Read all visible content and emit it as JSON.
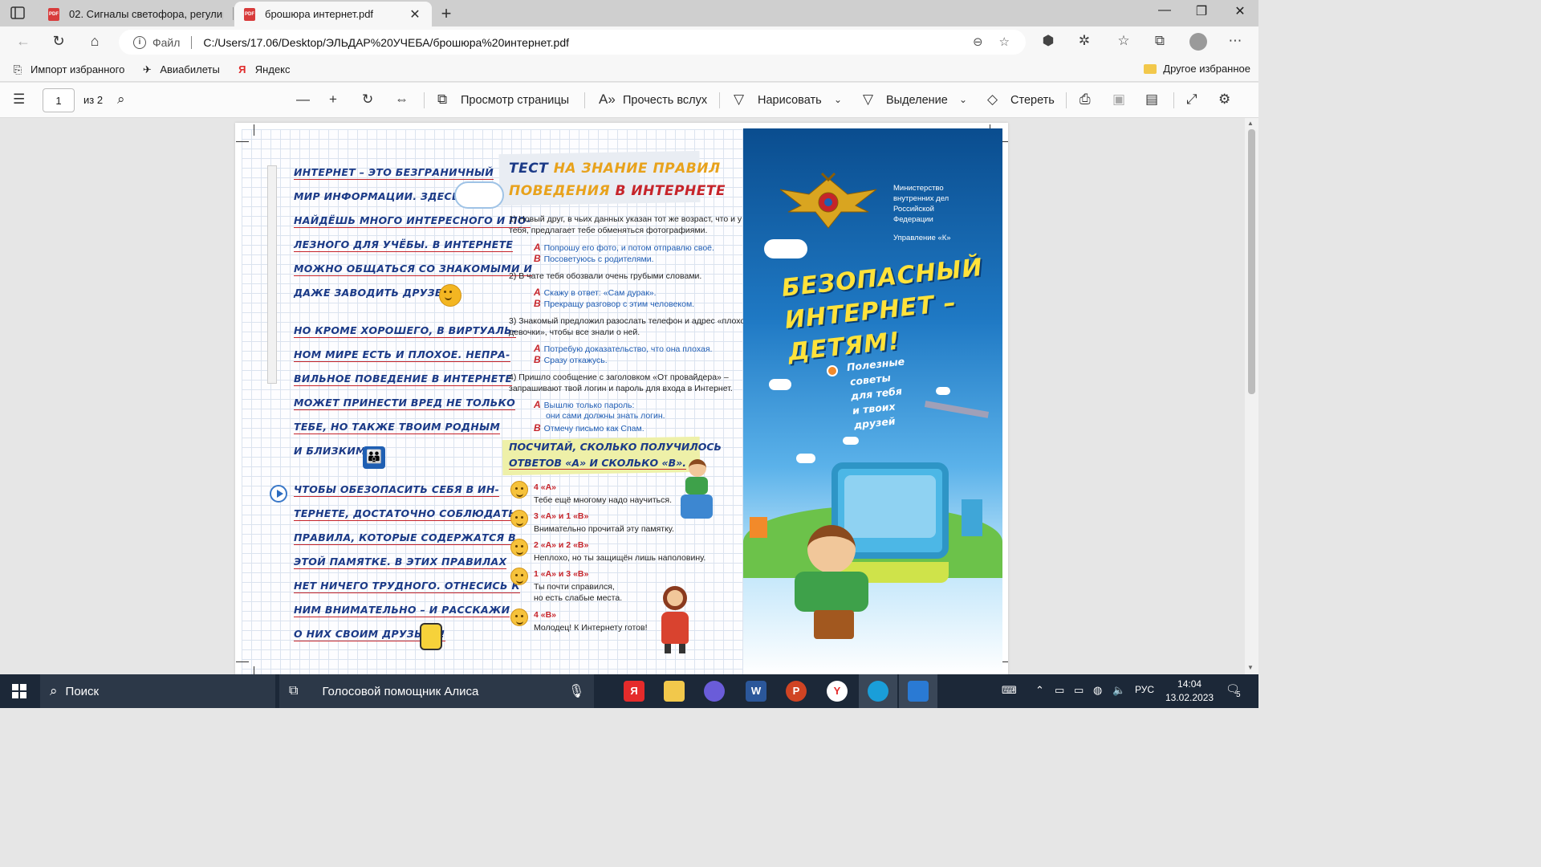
{
  "browser": {
    "tabs": [
      {
        "title": "02. Сигналы светофора, регулир",
        "active": false,
        "icon": "pdf-icon"
      },
      {
        "title": "брошюра интернет.pdf",
        "active": true,
        "icon": "pdf-icon"
      }
    ],
    "address": {
      "scheme_label": "Файл",
      "path": "C:/Users/17.06/Desktop/ЭЛЬДАР%20УЧЕБА/брошюра%20интернет.pdf"
    },
    "favorites": [
      {
        "label": "Импорт избранного",
        "icon": "import-icon"
      },
      {
        "label": "Авиабилеты",
        "icon": "plane-icon"
      },
      {
        "label": "Яндекс",
        "icon": "yandex-icon"
      }
    ],
    "other_favorites": "Другое избранное"
  },
  "pdf_toolbar": {
    "page_number": "1",
    "page_total": "из 2",
    "view_label": "Просмотр страницы",
    "read_aloud_label": "Прочесть вслух",
    "draw_label": "Нарисовать",
    "highlight_label": "Выделение",
    "erase_label": "Стереть"
  },
  "brochure": {
    "left_lines": [
      "интернет – это безграничный",
      "мир информации. Здесь ты",
      "найдёшь много интересного и по-",
      "лезного для учёбы. В Интернете",
      "можно общаться со знакомыми и",
      "даже заводить друзей.",
      "Но кроме хорошего, в виртуаль-",
      "ном мире есть и плохое. Непра-",
      "вильное поведение в Интернете",
      "может принести вред не только",
      "тебе, но также твоим родным",
      "и близким.",
      "Чтобы обезопасить себя в Ин-",
      "тернете, достаточно соблюдать",
      "правила, которые содержатся в",
      "этой памятке. В этих правилах",
      "нет ничего трудного. Отнесись к",
      "ним внимательно – и расскажи",
      "о них своим друзьям!"
    ],
    "test_title_1a": "Тест",
    "test_title_1b": "на знание правил",
    "test_title_2a": "поведения",
    "test_title_2b": "в Интернете",
    "questions": [
      {
        "lines": [
          "1)  Новый друг, в чьих данных указан тот же возраст, что и у",
          "     тебя, предлагает тебе обменяться фотографиями."
        ],
        "a": "Попрошу его фото, и потом отправлю своё.",
        "b": "Посоветуюсь с родителями."
      },
      {
        "lines": [
          "2)  В чате тебя обозвали очень грубыми словами."
        ],
        "a": "Скажу в ответ: «Сам дурак».",
        "b": "Прекращу разговор с этим человеком."
      },
      {
        "lines": [
          "3)  Знакомый предложил разослать телефон и адрес «плохой",
          "     девочки», чтобы все знали о ней."
        ],
        "a": "Потребую доказательство, что она плохая.",
        "b": "Сразу откажусь."
      },
      {
        "lines": [
          "4)  Пришло сообщение с заголовком «От провайдера» –",
          "     запрашивают твой логин и пароль для входа в Интернет."
        ],
        "a": "Вышлю только пароль:",
        "a2": "они сами должны знать логин.",
        "b": "Отмечу письмо как Спам."
      }
    ],
    "letter_a": "А",
    "letter_b": "В",
    "count_line_1": "Посчитай, сколько получилось",
    "count_line_2": "ответов «А» и сколько «В».",
    "results": [
      {
        "title": "4 «А»",
        "text": [
          "Тебе ещё многому надо научиться."
        ]
      },
      {
        "title": "3 «А» и 1 «В»",
        "text": [
          "Внимательно прочитай эту памятку."
        ]
      },
      {
        "title": "2 «А» и 2 «В»",
        "text": [
          "Неплохо, но ты защищён лишь наполовину."
        ]
      },
      {
        "title": "1 «А» и 3 «В»",
        "text": [
          "Ты почти справился,",
          "но есть слабые места."
        ]
      },
      {
        "title": "4 «В»",
        "text": [
          "Молодец! К Интернету готов!"
        ]
      }
    ],
    "ministry": [
      "Министерство",
      "внутренних дел",
      "Российской",
      "Федерации"
    ],
    "department": "Управление «К»",
    "cover_title": [
      "БЕЗОПАСНЫЙ",
      "ИНТЕРНЕТ –",
      "ДЕТЯМ!"
    ],
    "cover_sub": [
      "Полезные",
      "советы",
      "для тебя",
      "и твоих",
      "друзей"
    ]
  },
  "taskbar": {
    "search_placeholder": "Поиск",
    "alisa_label": "Голосовой помощник Алиса",
    "lang": "РУС",
    "time": "14:04",
    "date": "13.02.2023",
    "notifications": "5"
  },
  "colors": {
    "heading_blue": "#1b3a87",
    "accent_red": "#c6242a",
    "accent_orange": "#e8a21c",
    "answer_blue": "#1e5cb3",
    "cover_yellow": "#ffe23a"
  }
}
